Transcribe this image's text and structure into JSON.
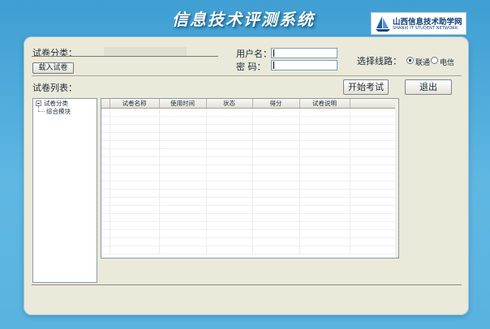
{
  "header": {
    "title": "信息技术评测系统",
    "logo": {
      "name": "山西信息技术助学网",
      "subtitle": "SHANXI IT STUDENT NETWORK"
    }
  },
  "form": {
    "category_label": "试卷分类：",
    "category_value": "",
    "load_button": "载入试卷",
    "username_label": "用户名：",
    "username_value": "",
    "password_label": "密  码：",
    "password_value": "",
    "line_label": "选择线路：",
    "line_options": [
      {
        "label": "联通",
        "selected": true
      },
      {
        "label": "电信",
        "selected": false
      }
    ]
  },
  "list": {
    "label": "试卷列表：",
    "start_button": "开始考试",
    "exit_button": "退出"
  },
  "tree": {
    "root": "试卷分类",
    "children": [
      "综合模块"
    ]
  },
  "table": {
    "columns": [
      "试卷名称",
      "使用时间",
      "状态",
      "得分",
      "试卷说明"
    ],
    "rows": []
  },
  "colors": {
    "background": "#4ea9d9",
    "panel": "#ebe9d9",
    "title_text": "#ffffff"
  }
}
